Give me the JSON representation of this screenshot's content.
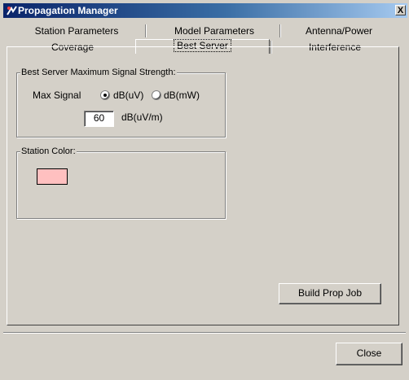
{
  "window": {
    "title": "Propagation Manager",
    "close_glyph": "X"
  },
  "tabs": {
    "row1": [
      "Station Parameters",
      "Model Parameters",
      "Antenna/Power"
    ],
    "row2": [
      "Coverage",
      "Best Server",
      "Interference"
    ],
    "active": "Best Server"
  },
  "best_server": {
    "group_title": "Best Server Maximum Signal Strength:",
    "max_signal_label": "Max Signal",
    "options": [
      "dB(uV)",
      "dB(mW)"
    ],
    "selected": "dB(uV)",
    "value": "60",
    "unit": "dB(uV/m)"
  },
  "station_color": {
    "group_title": "Station Color:",
    "color": "#ffc0c0"
  },
  "buttons": {
    "build": "Build Prop Job",
    "close": "Close"
  },
  "colors": {
    "title_start": "#0a246a",
    "title_end": "#a6caf0",
    "face": "#d4d0c8"
  }
}
